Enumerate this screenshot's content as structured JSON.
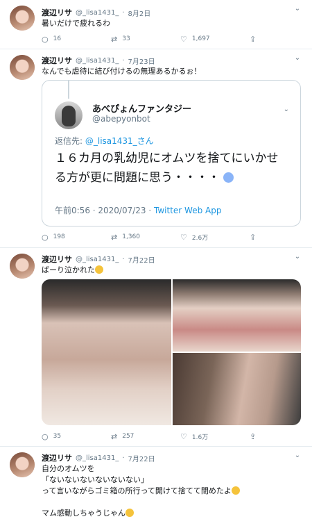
{
  "tweets": [
    {
      "name": "渡辺リサ",
      "handle": "@_lisa1431_",
      "date": "8月2日",
      "lines": [
        "暑いだけで疲れるわ"
      ],
      "replies": "16",
      "retweets": "33",
      "likes": "1,697"
    },
    {
      "name": "渡辺リサ",
      "handle": "@_lisa1431_",
      "date": "7月23日",
      "lines": [
        "なんでも虐待に結び付けるの無理あるかるぉ！"
      ],
      "replies": "198",
      "retweets": "1,360",
      "likes": "2.6万"
    },
    {
      "name": "渡辺リサ",
      "handle": "@_lisa1431_",
      "date": "7月22日",
      "lines": [
        "ばーり泣かれた"
      ],
      "replies": "35",
      "retweets": "257",
      "likes": "1.6万"
    },
    {
      "name": "渡辺リサ",
      "handle": "@_lisa1431_",
      "date": "7月22日",
      "lines": [
        "自分のオムツを",
        "「ないないないないないない」",
        "って言いながらゴミ箱の所行って開けて捨てて閉めたよ",
        "",
        "マム感動しちゃうじゃん"
      ]
    }
  ],
  "quote": {
    "name": "あべぴょんファンタジー",
    "handle": "@abepyonbot",
    "reply_prefix": "返信先: ",
    "reply_to": "@_lisa1431_さん",
    "text": "１６カ月の乳幼児にオムツを捨てにいかせる方が更に問題に思う・・・・",
    "time": "午前0:56 · 2020/07/23 · ",
    "app": "Twitter Web App"
  },
  "icons": {
    "reply": "reply-icon",
    "retweet": "retweet-icon",
    "like": "heart-icon",
    "share": "share-icon",
    "caret": "chevron-down-icon"
  },
  "colors": {
    "link": "#1b95e0",
    "muted": "#657786",
    "border": "#e6ecf0"
  }
}
